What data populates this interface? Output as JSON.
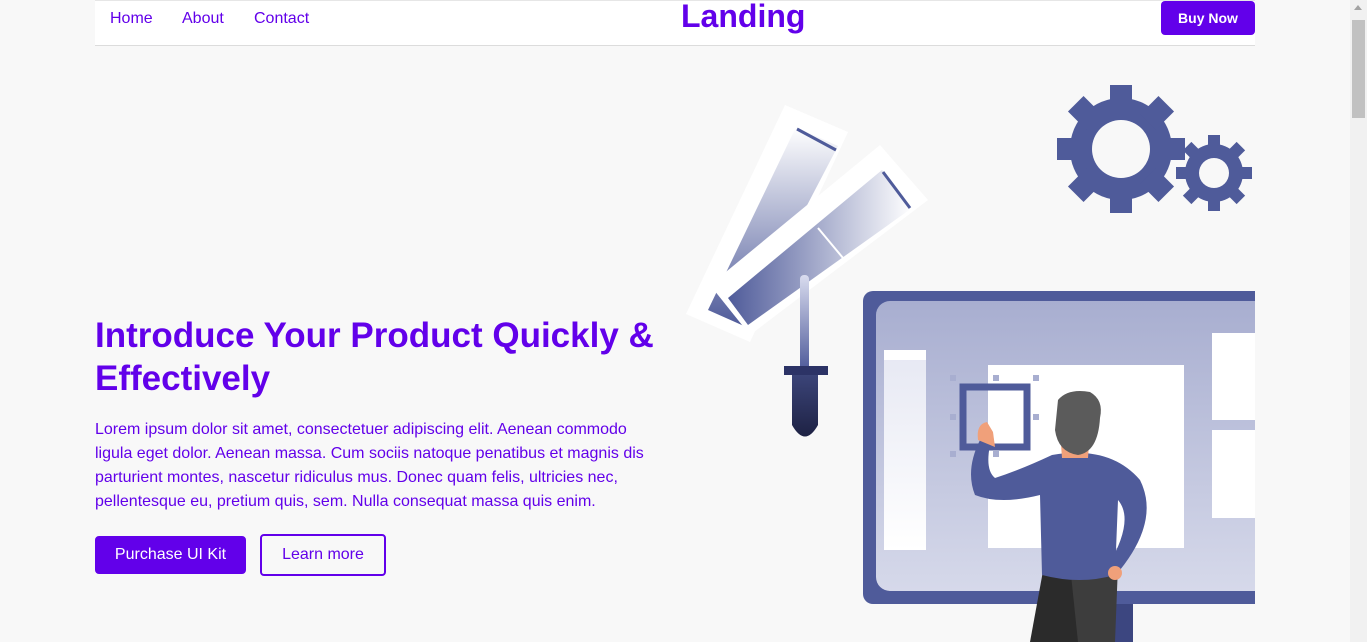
{
  "nav": {
    "links": [
      "Home",
      "About",
      "Contact"
    ],
    "brand": "Landing",
    "cta": "Buy Now"
  },
  "hero": {
    "title": "Introduce Your Product Quickly & Effectively",
    "body": "Lorem ipsum dolor sit amet, consectetuer adipiscing elit. Aenean commodo ligula eget dolor. Aenean massa. Cum sociis natoque penatibus et magnis dis parturient montes, nascetur ridiculus mus. Donec quam felis, ultricies nec, pellentesque eu, pretium quis, sem. Nulla consequat massa quis enim.",
    "primary_button": "Purchase UI Kit",
    "secondary_button": "Learn more"
  },
  "colors": {
    "accent": "#6200ea",
    "illustration": "#4f5b9a"
  },
  "icons": [
    "gear-icon",
    "color-swatch-icon",
    "dropper-icon",
    "monitor-icon"
  ]
}
